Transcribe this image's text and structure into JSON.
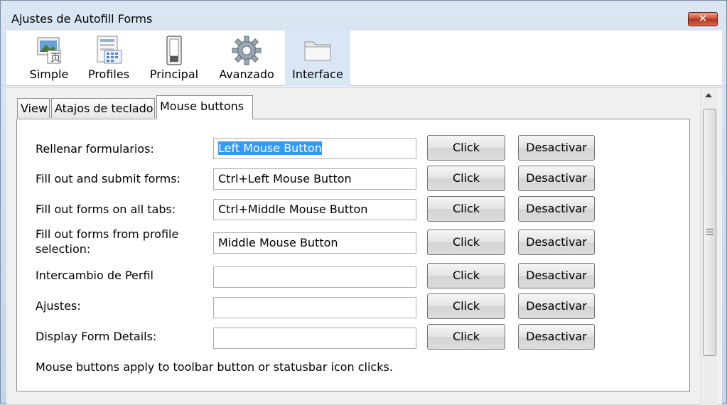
{
  "window": {
    "title": "Ajustes de Autofill Forms",
    "close_symbol": "✕"
  },
  "toolbar": {
    "items": [
      {
        "label": "Simple",
        "icon": "simple-icon"
      },
      {
        "label": "Profiles",
        "icon": "profiles-icon"
      },
      {
        "label": "Principal",
        "icon": "principal-icon"
      },
      {
        "label": "Avanzado",
        "icon": "gear-icon"
      },
      {
        "label": "Interface",
        "icon": "folder-icon",
        "selected": true
      }
    ]
  },
  "tabs": [
    {
      "label": "View"
    },
    {
      "label": "Atajos de teclado"
    },
    {
      "label": "Mouse buttons",
      "active": true
    }
  ],
  "rows": [
    {
      "label": "Rellenar formularios:",
      "value": "Left Mouse Button",
      "selected": true
    },
    {
      "label": "Fill out and submit forms:",
      "value": "Ctrl+Left Mouse Button"
    },
    {
      "label": "Fill out forms on all tabs:",
      "value": "Ctrl+Middle Mouse Button"
    },
    {
      "label": "Fill out forms from profile selection:",
      "value": "Middle Mouse Button"
    },
    {
      "label": "Intercambio de Perfil",
      "value": ""
    },
    {
      "label": "Ajustes:",
      "value": ""
    },
    {
      "label": "Display Form Details:",
      "value": ""
    }
  ],
  "buttons": {
    "click_label": "Click",
    "deactivate_label": "Desactivar"
  },
  "note": "Mouse buttons apply to toolbar button or statusbar icon clicks.",
  "colors": {
    "selection": "#3399ff",
    "selected_toolbar": "#d8e6f5",
    "close": "#c8462d"
  }
}
